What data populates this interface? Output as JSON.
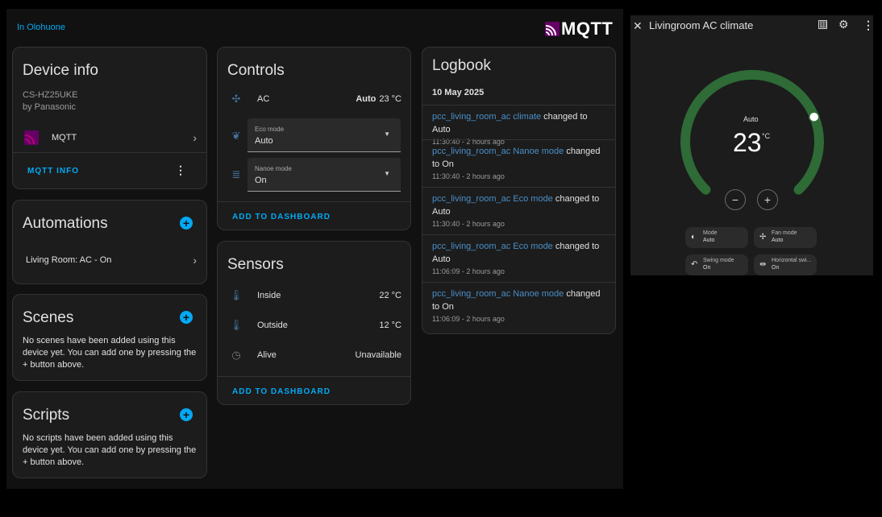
{
  "area": {
    "link": "In Olohuone"
  },
  "logo": {
    "word": "MQTT"
  },
  "device_info": {
    "title": "Device info",
    "model": "CS-HZ25UKE",
    "manufacturer": "by Panasonic",
    "integration": "MQTT",
    "action": "MQTT INFO"
  },
  "automations": {
    "title": "Automations",
    "items": [
      {
        "label": "Living Room: AC - On"
      }
    ]
  },
  "scenes": {
    "title": "Scenes",
    "empty_text": "No scenes have been added using this device yet. You can add one by pressing the + button above."
  },
  "scripts": {
    "title": "Scripts",
    "empty_text": "No scripts have been added using this device yet. You can add one by pressing the + button above."
  },
  "controls": {
    "title": "Controls",
    "ac": {
      "label": "AC",
      "mode": "Auto",
      "temp": "23 °C"
    },
    "eco": {
      "label": "Eco mode",
      "value": "Auto"
    },
    "nanoe": {
      "label": "Nanoe mode",
      "value": "On"
    },
    "add_btn": "ADD TO DASHBOARD"
  },
  "sensors": {
    "title": "Sensors",
    "items": [
      {
        "label": "Inside",
        "value": "22 °C"
      },
      {
        "label": "Outside",
        "value": "12 °C"
      },
      {
        "label": "Alive",
        "value": "Unavailable"
      }
    ],
    "add_btn": "ADD TO DASHBOARD"
  },
  "logbook": {
    "title": "Logbook",
    "date": "10 May 2025",
    "entries": [
      {
        "entity": "pcc_living_room_ac climate",
        "text": " changed to Auto",
        "time": "11:30:40 - 2 hours ago"
      },
      {
        "entity": "pcc_living_room_ac Nanoe mode",
        "text": " changed to On",
        "time": "11:30:40 - 2 hours ago"
      },
      {
        "entity": "pcc_living_room_ac Eco mode",
        "text": " changed to Auto",
        "time": "11:30:40 - 2 hours ago"
      },
      {
        "entity": "pcc_living_room_ac Eco mode",
        "text": " changed to Auto",
        "time": "11:06:09 - 2 hours ago"
      },
      {
        "entity": "pcc_living_room_ac Nanoe mode",
        "text": " changed to On",
        "time": "11:06:09 - 2 hours ago"
      }
    ]
  },
  "dialog": {
    "title": "Livingroom AC climate",
    "mode_label": "Auto",
    "temp": "23",
    "unit": "°C",
    "target_fraction": 0.75,
    "pills": [
      {
        "label": "Mode",
        "value": "Auto"
      },
      {
        "label": "Fan mode",
        "value": "Auto"
      },
      {
        "label": "Swing mode",
        "value": "On"
      },
      {
        "label": "Horizontal swi...",
        "value": "On"
      }
    ]
  },
  "colors": {
    "accent": "#03a9f4",
    "gauge": "#2e6b36",
    "icon": "#44739e",
    "mqtt_logo": "#660066"
  }
}
